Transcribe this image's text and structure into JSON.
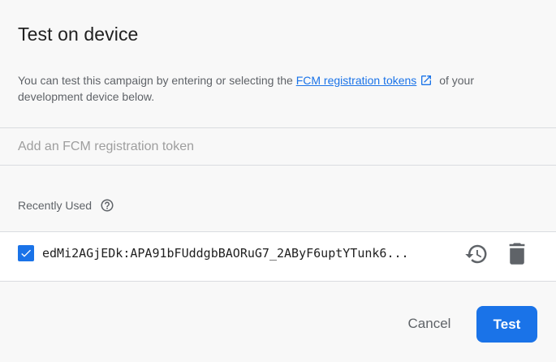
{
  "dialog": {
    "title": "Test on device",
    "description": {
      "before_link": "You can test this campaign by entering or selecting the ",
      "link_text": "FCM registration tokens",
      "after_link": " of your development device below."
    },
    "token_input": {
      "placeholder": "Add an FCM registration token",
      "value": ""
    },
    "recently_used": {
      "label": "Recently Used",
      "tokens": [
        {
          "text": "edMi2AGjEDk:APA91bFUddgbBAORuG7_2AByF6uptYTunk6...",
          "checked": true
        }
      ]
    },
    "footer": {
      "cancel_label": "Cancel",
      "test_label": "Test"
    }
  },
  "colors": {
    "accent": "#1a73e8",
    "background": "#f8f8f8",
    "secondary_text": "#5f6368"
  },
  "icons": [
    "external-link-icon",
    "help-icon",
    "checkbox-checked-icon",
    "history-icon",
    "delete-icon"
  ]
}
